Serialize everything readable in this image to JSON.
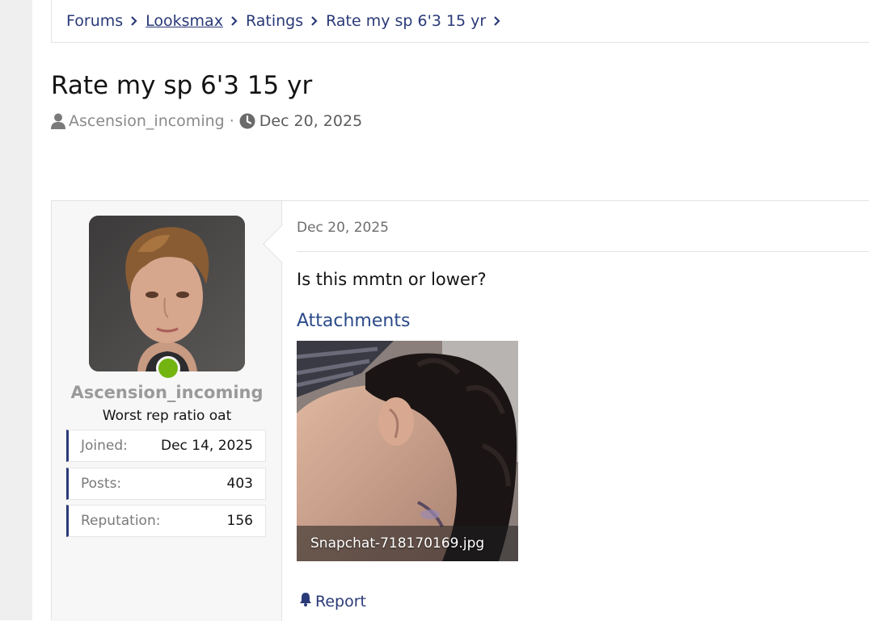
{
  "breadcrumb": {
    "items": [
      {
        "label": "Forums"
      },
      {
        "label": "Looksmax"
      },
      {
        "label": "Ratings"
      },
      {
        "label": "Rate my sp 6'3 15 yr"
      }
    ]
  },
  "thread": {
    "title": "Rate my sp 6'3 15 yr",
    "author": "Ascension_incoming",
    "separator": "·",
    "date": "Dec 20, 2025"
  },
  "user": {
    "username": "Ascension_incoming",
    "user_title": "Worst rep ratio oat",
    "status": "online",
    "stats": [
      {
        "key": "Joined:",
        "value": "Dec 14, 2025"
      },
      {
        "key": "Posts:",
        "value": "403"
      },
      {
        "key": "Reputation:",
        "value": "156"
      }
    ]
  },
  "post": {
    "date": "Dec 20, 2025",
    "body": "Is this mmtn or lower?",
    "attachments_heading": "Attachments",
    "attachment_filename": "Snapchat-718170169.jpg",
    "report_label": "Report"
  },
  "icons": {
    "breadcrumb_separator": "chevron-right-icon",
    "author": "user-icon",
    "date": "clock-icon",
    "report": "bell-icon"
  },
  "colors": {
    "link": "#2a3a78",
    "online": "#74b411",
    "heading_link": "#2a4a88"
  }
}
